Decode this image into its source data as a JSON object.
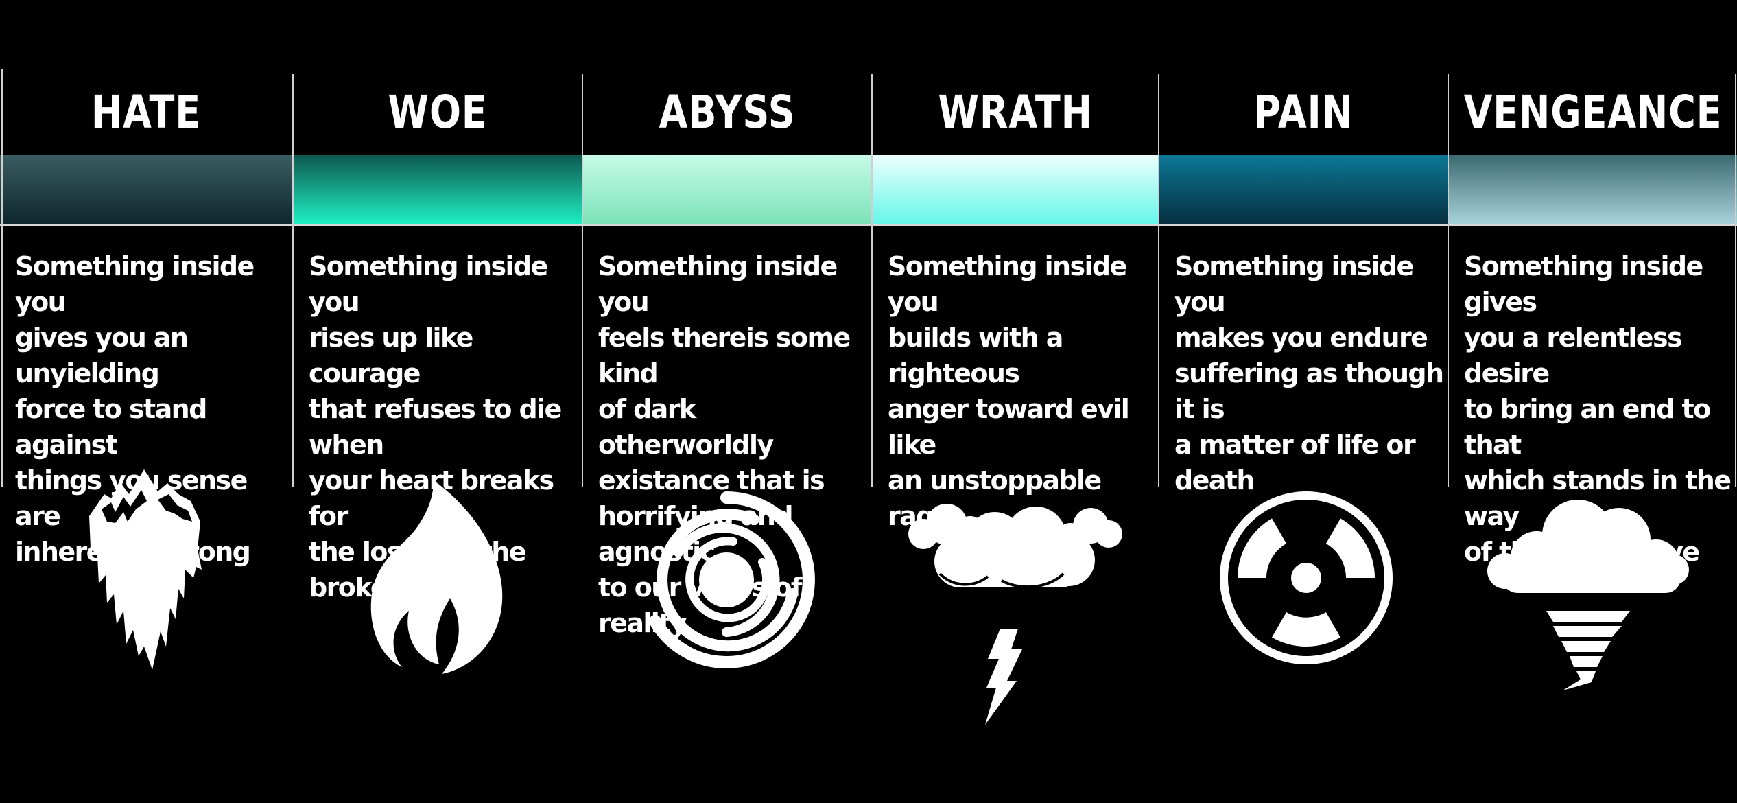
{
  "columns": [
    {
      "title": "HATE",
      "description": "Something inside you\ngives you an unyielding\nforce to stand against\nthings you sense are\ninherently wrong",
      "icon": "iceberg-icon",
      "gradient": [
        "#3b5c62",
        "#0c262c"
      ]
    },
    {
      "title": "WOE",
      "description": "Something inside you\nrises up like courage\nthat refuses to die when\nyour heart breaks for\nthe lost and the broken",
      "icon": "flame-icon",
      "gradient": [
        "#0d5a50",
        "#1ff2c6"
      ]
    },
    {
      "title": "ABYSS",
      "description": "Something inside you\nfeels thereis some kind\nof dark otherworldly\nexistance that is\nhorrifying and agnostic\nto our views of reality",
      "icon": "vortex-icon",
      "gradient": [
        "#c6fbe8",
        "#7ae2b8"
      ]
    },
    {
      "title": "WRATH",
      "description": "Something inside you\nbuilds with a righteous\nanger toward evil like\nan unstoppable rage",
      "icon": "storm-cloud-lightning-icon",
      "gradient": [
        "#ecfffd",
        "#63f6ea"
      ]
    },
    {
      "title": "PAIN",
      "description": "Something inside you\nmakes you endure\nsuffering as though it is\na matter of life or death",
      "icon": "radiation-icon",
      "gradient": [
        "#0c7896",
        "#062e3e"
      ]
    },
    {
      "title": "VENGEANCE",
      "description": "Something inside gives\nyou a relentless desire\nto bring an end to that\nwhich stands in the way\nof those you love",
      "icon": "tornado-cloud-icon",
      "gradient": [
        "#3b6a70",
        "#a9d6dc"
      ]
    }
  ]
}
